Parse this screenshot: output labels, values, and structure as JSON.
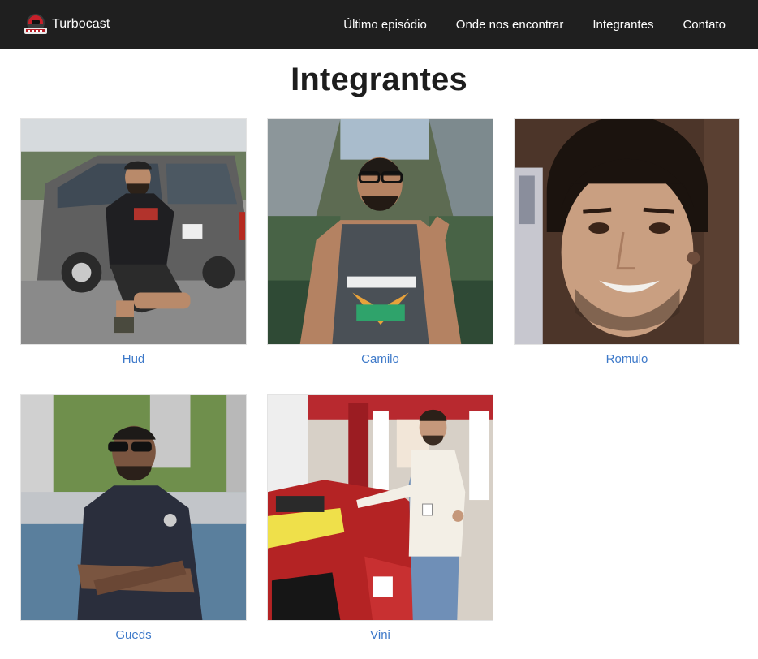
{
  "header": {
    "brand_name": "Turbocast",
    "logo_icon": "turbocast-logo-icon",
    "nav": [
      {
        "label": "Último episódio"
      },
      {
        "label": "Onde nos encontrar"
      },
      {
        "label": "Integrantes"
      },
      {
        "label": "Contato"
      }
    ]
  },
  "main": {
    "title": "Integrantes",
    "members": [
      {
        "name": "Hud"
      },
      {
        "name": "Camilo"
      },
      {
        "name": "Romulo"
      },
      {
        "name": "Gueds"
      },
      {
        "name": "Vini"
      }
    ]
  },
  "colors": {
    "navbar_bg": "#1f1f1f",
    "link_blue": "#3d79c9",
    "title_text": "#1d1d1d"
  }
}
